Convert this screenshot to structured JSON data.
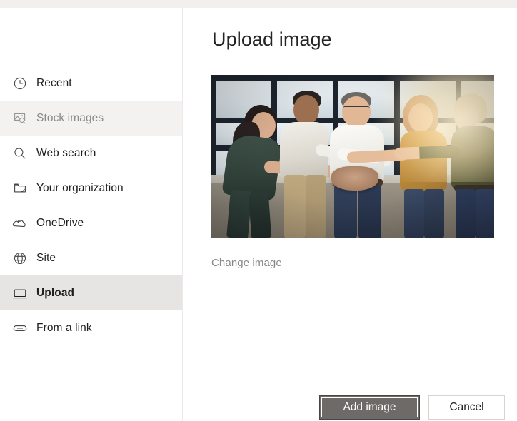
{
  "dialog": {
    "title": "Upload image"
  },
  "sidebar": {
    "items": [
      {
        "label": "Recent",
        "icon": "clock-icon",
        "state": "normal"
      },
      {
        "label": "Stock images",
        "icon": "stock-image-icon",
        "state": "hover"
      },
      {
        "label": "Web search",
        "icon": "search-icon",
        "state": "normal"
      },
      {
        "label": "Your organization",
        "icon": "folder-check-icon",
        "state": "normal"
      },
      {
        "label": "OneDrive",
        "icon": "onedrive-cloud-icon",
        "state": "normal"
      },
      {
        "label": "Site",
        "icon": "globe-icon",
        "state": "normal"
      },
      {
        "label": "Upload",
        "icon": "monitor-icon",
        "state": "selected"
      },
      {
        "label": "From a link",
        "icon": "link-icon",
        "state": "normal"
      }
    ]
  },
  "main": {
    "preview_alt": "Five colleagues joining hands together in a bright office with large windows",
    "change_image_label": "Change image"
  },
  "footer": {
    "primary_label": "Add image",
    "secondary_label": "Cancel"
  },
  "colors": {
    "strip": "#f1f0ee",
    "selected_row": "#e6e5e3",
    "hover_row": "#f3f2f1",
    "primary_button": "#6e6a67",
    "primary_button_border": "#484644",
    "secondary_button_border": "#d6d3d1",
    "title_text": "#242424",
    "muted_text": "#8a8886",
    "divider": "#edebe9"
  }
}
